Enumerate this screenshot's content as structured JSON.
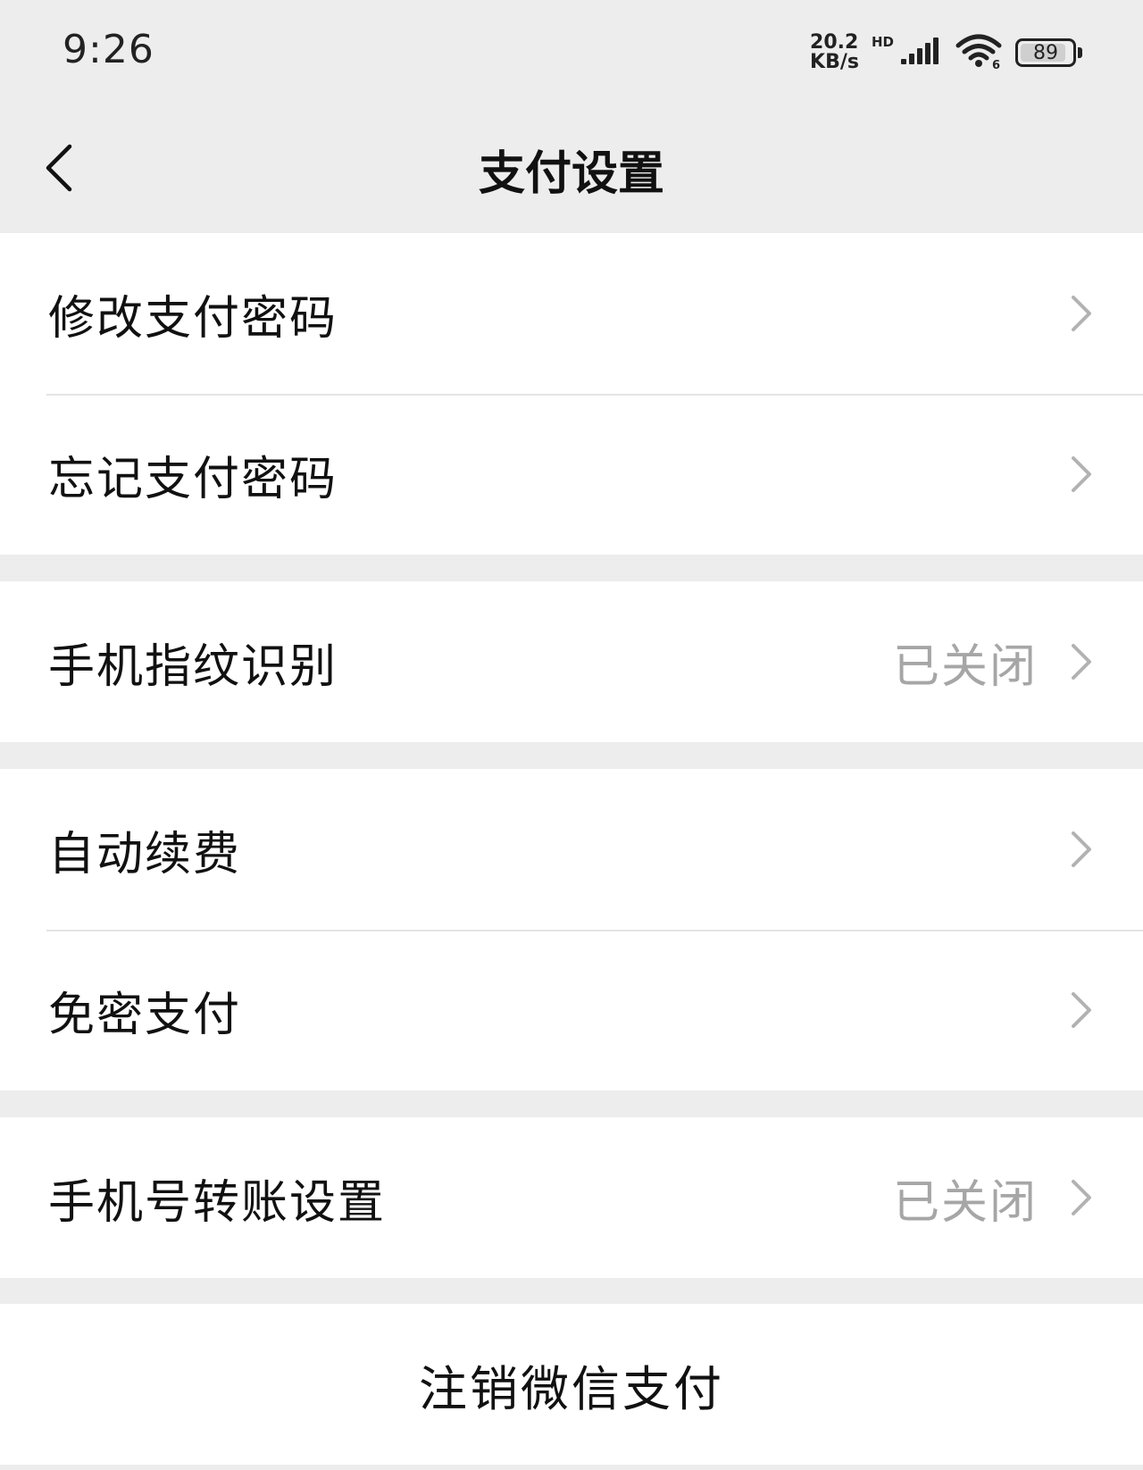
{
  "status_bar": {
    "time": "9:26",
    "net_speed_value": "20.2",
    "net_speed_unit": "KB/s",
    "hd_label": "HD",
    "battery_level": "89",
    "battery_fraction": 0.89,
    "icons": [
      "signal-icon",
      "wifi-icon",
      "battery-icon"
    ]
  },
  "nav": {
    "title": "支付设置",
    "back_icon": "chevron-left-icon"
  },
  "groups": [
    {
      "items": [
        {
          "label": "修改支付密码",
          "value": ""
        },
        {
          "label": "忘记支付密码",
          "value": ""
        }
      ]
    },
    {
      "items": [
        {
          "label": "手机指纹识别",
          "value": "已关闭"
        }
      ]
    },
    {
      "items": [
        {
          "label": "自动续费",
          "value": ""
        },
        {
          "label": "免密支付",
          "value": ""
        }
      ]
    },
    {
      "items": [
        {
          "label": "手机号转账设置",
          "value": "已关闭"
        }
      ]
    }
  ],
  "cancel_button": {
    "label": "注销微信支付"
  },
  "colors": {
    "background": "#ededed",
    "card": "#ffffff",
    "text": "#111111",
    "secondary_text": "#a6a6a6",
    "chevron": "#b2b2b2"
  }
}
